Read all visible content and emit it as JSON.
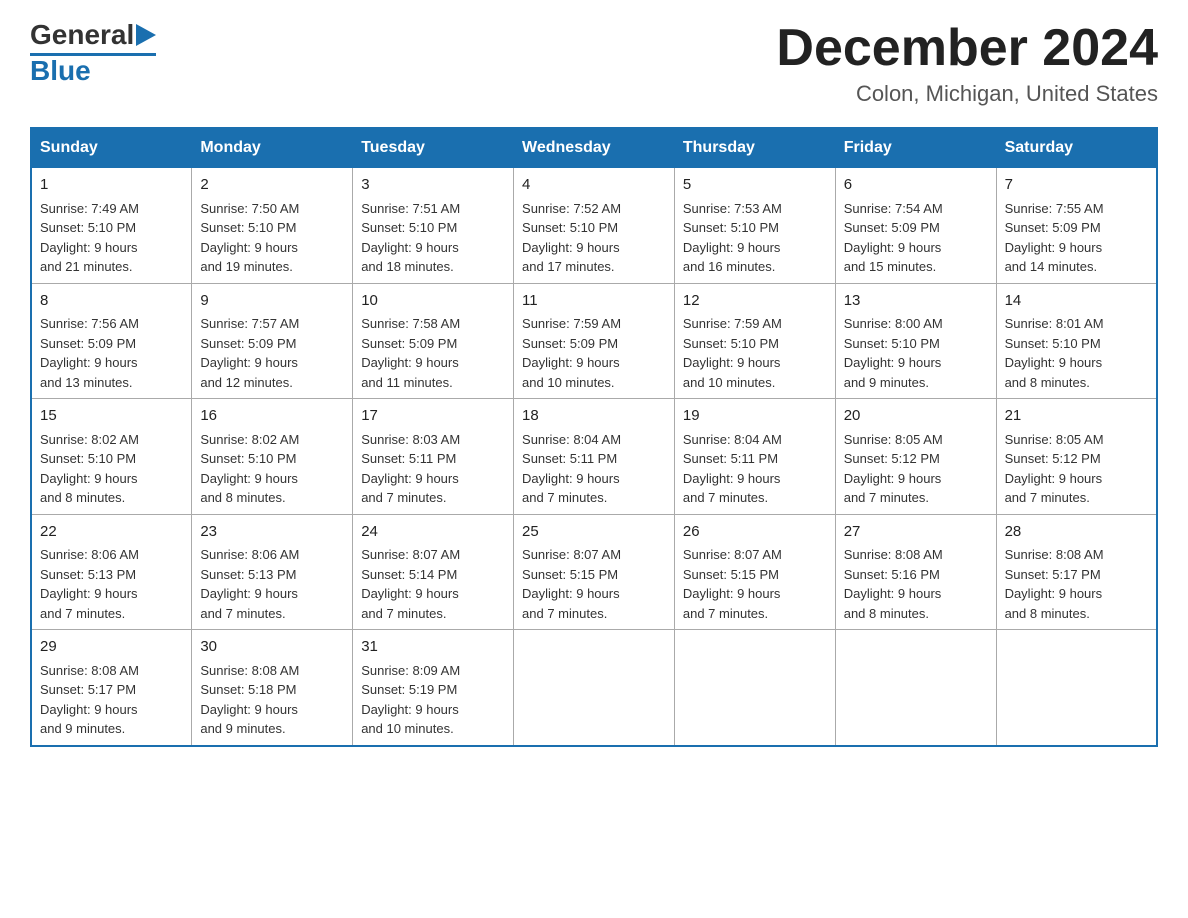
{
  "header": {
    "logo_general": "General",
    "logo_blue": "Blue",
    "month_title": "December 2024",
    "location": "Colon, Michigan, United States"
  },
  "weekdays": [
    "Sunday",
    "Monday",
    "Tuesday",
    "Wednesday",
    "Thursday",
    "Friday",
    "Saturday"
  ],
  "weeks": [
    [
      {
        "day": "1",
        "sunrise": "7:49 AM",
        "sunset": "5:10 PM",
        "daylight": "9 hours and 21 minutes."
      },
      {
        "day": "2",
        "sunrise": "7:50 AM",
        "sunset": "5:10 PM",
        "daylight": "9 hours and 19 minutes."
      },
      {
        "day": "3",
        "sunrise": "7:51 AM",
        "sunset": "5:10 PM",
        "daylight": "9 hours and 18 minutes."
      },
      {
        "day": "4",
        "sunrise": "7:52 AM",
        "sunset": "5:10 PM",
        "daylight": "9 hours and 17 minutes."
      },
      {
        "day": "5",
        "sunrise": "7:53 AM",
        "sunset": "5:10 PM",
        "daylight": "9 hours and 16 minutes."
      },
      {
        "day": "6",
        "sunrise": "7:54 AM",
        "sunset": "5:09 PM",
        "daylight": "9 hours and 15 minutes."
      },
      {
        "day": "7",
        "sunrise": "7:55 AM",
        "sunset": "5:09 PM",
        "daylight": "9 hours and 14 minutes."
      }
    ],
    [
      {
        "day": "8",
        "sunrise": "7:56 AM",
        "sunset": "5:09 PM",
        "daylight": "9 hours and 13 minutes."
      },
      {
        "day": "9",
        "sunrise": "7:57 AM",
        "sunset": "5:09 PM",
        "daylight": "9 hours and 12 minutes."
      },
      {
        "day": "10",
        "sunrise": "7:58 AM",
        "sunset": "5:09 PM",
        "daylight": "9 hours and 11 minutes."
      },
      {
        "day": "11",
        "sunrise": "7:59 AM",
        "sunset": "5:09 PM",
        "daylight": "9 hours and 10 minutes."
      },
      {
        "day": "12",
        "sunrise": "7:59 AM",
        "sunset": "5:10 PM",
        "daylight": "9 hours and 10 minutes."
      },
      {
        "day": "13",
        "sunrise": "8:00 AM",
        "sunset": "5:10 PM",
        "daylight": "9 hours and 9 minutes."
      },
      {
        "day": "14",
        "sunrise": "8:01 AM",
        "sunset": "5:10 PM",
        "daylight": "9 hours and 8 minutes."
      }
    ],
    [
      {
        "day": "15",
        "sunrise": "8:02 AM",
        "sunset": "5:10 PM",
        "daylight": "9 hours and 8 minutes."
      },
      {
        "day": "16",
        "sunrise": "8:02 AM",
        "sunset": "5:10 PM",
        "daylight": "9 hours and 8 minutes."
      },
      {
        "day": "17",
        "sunrise": "8:03 AM",
        "sunset": "5:11 PM",
        "daylight": "9 hours and 7 minutes."
      },
      {
        "day": "18",
        "sunrise": "8:04 AM",
        "sunset": "5:11 PM",
        "daylight": "9 hours and 7 minutes."
      },
      {
        "day": "19",
        "sunrise": "8:04 AM",
        "sunset": "5:11 PM",
        "daylight": "9 hours and 7 minutes."
      },
      {
        "day": "20",
        "sunrise": "8:05 AM",
        "sunset": "5:12 PM",
        "daylight": "9 hours and 7 minutes."
      },
      {
        "day": "21",
        "sunrise": "8:05 AM",
        "sunset": "5:12 PM",
        "daylight": "9 hours and 7 minutes."
      }
    ],
    [
      {
        "day": "22",
        "sunrise": "8:06 AM",
        "sunset": "5:13 PM",
        "daylight": "9 hours and 7 minutes."
      },
      {
        "day": "23",
        "sunrise": "8:06 AM",
        "sunset": "5:13 PM",
        "daylight": "9 hours and 7 minutes."
      },
      {
        "day": "24",
        "sunrise": "8:07 AM",
        "sunset": "5:14 PM",
        "daylight": "9 hours and 7 minutes."
      },
      {
        "day": "25",
        "sunrise": "8:07 AM",
        "sunset": "5:15 PM",
        "daylight": "9 hours and 7 minutes."
      },
      {
        "day": "26",
        "sunrise": "8:07 AM",
        "sunset": "5:15 PM",
        "daylight": "9 hours and 7 minutes."
      },
      {
        "day": "27",
        "sunrise": "8:08 AM",
        "sunset": "5:16 PM",
        "daylight": "9 hours and 8 minutes."
      },
      {
        "day": "28",
        "sunrise": "8:08 AM",
        "sunset": "5:17 PM",
        "daylight": "9 hours and 8 minutes."
      }
    ],
    [
      {
        "day": "29",
        "sunrise": "8:08 AM",
        "sunset": "5:17 PM",
        "daylight": "9 hours and 9 minutes."
      },
      {
        "day": "30",
        "sunrise": "8:08 AM",
        "sunset": "5:18 PM",
        "daylight": "9 hours and 9 minutes."
      },
      {
        "day": "31",
        "sunrise": "8:09 AM",
        "sunset": "5:19 PM",
        "daylight": "9 hours and 10 minutes."
      },
      null,
      null,
      null,
      null
    ]
  ],
  "labels": {
    "sunrise": "Sunrise:",
    "sunset": "Sunset:",
    "daylight": "Daylight:"
  }
}
